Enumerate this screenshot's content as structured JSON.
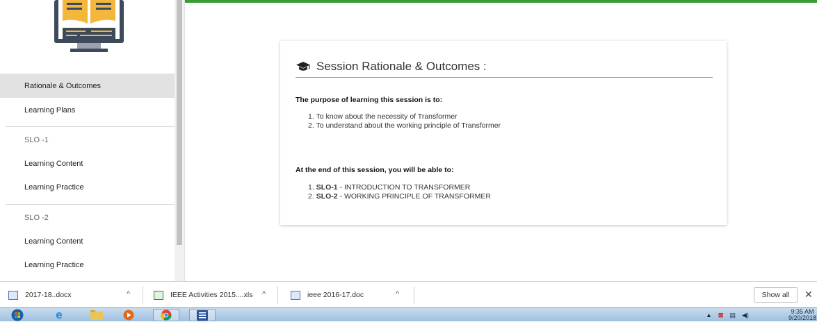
{
  "sidebar": {
    "items": [
      {
        "label": "Rationale & Outcomes",
        "active": true
      },
      {
        "label": "Learning Plans"
      },
      {
        "label": "SLO -1",
        "section": true
      },
      {
        "label": "Learning Content"
      },
      {
        "label": "Learning Practice"
      },
      {
        "label": "SLO -2",
        "section": true
      },
      {
        "label": "Learning Content"
      },
      {
        "label": "Learning Practice"
      }
    ]
  },
  "card": {
    "title": "Session Rationale & Outcomes :",
    "purpose_heading": "The purpose of learning this session is to:",
    "purpose_items": [
      "1. To know about the necessity of Transformer",
      "2. To understand about the working principle of Transformer"
    ],
    "outcomes_heading": "At the end of this session, you will be able to:",
    "outcomes": [
      {
        "num": "1.",
        "code": "SLO-1",
        "text": " - INTRODUCTION TO TRANSFORMER"
      },
      {
        "num": "2.",
        "code": "SLO-2",
        "text": " - WORKING PRINCIPLE OF TRANSFORMER"
      }
    ]
  },
  "downloads": {
    "files": [
      "2017-18..docx",
      "IEEE Activities 2015....xls",
      "ieee 2016-17.doc"
    ],
    "show_all": "Show all"
  },
  "taskbar": {
    "time": "9:35 AM",
    "date": "9/20/2018"
  },
  "colors": {
    "accent_green": "#3d9b35",
    "active_item_bg": "#e2e2e2"
  }
}
